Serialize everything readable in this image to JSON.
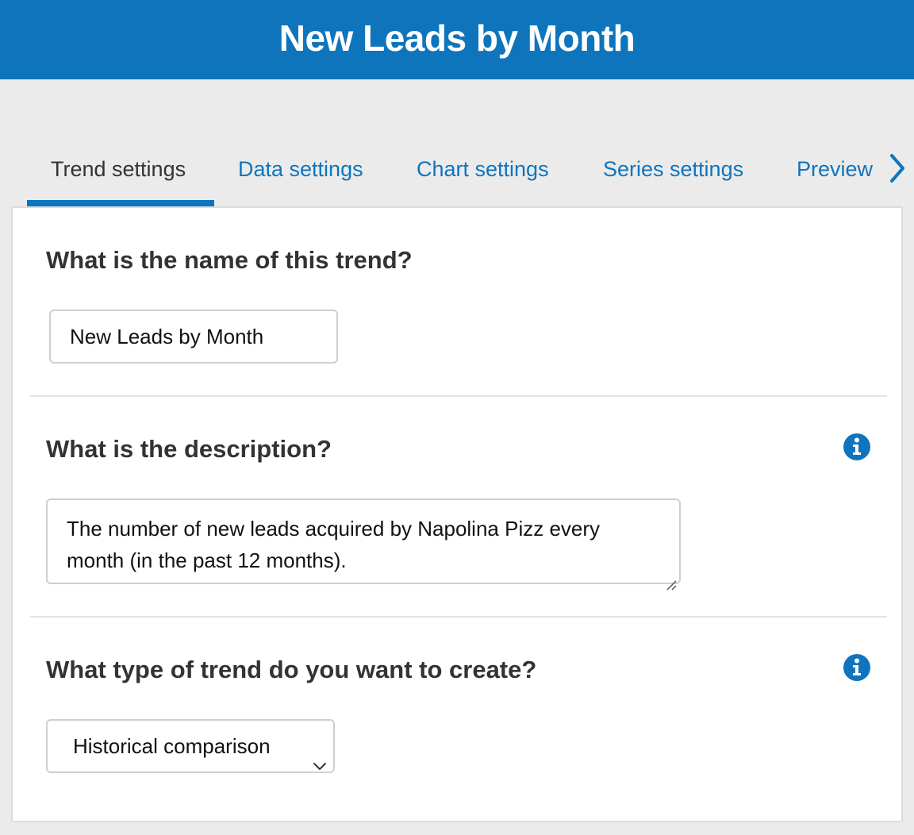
{
  "header": {
    "title": "New Leads by Month"
  },
  "tabs": [
    {
      "label": "Trend settings",
      "active": true
    },
    {
      "label": "Data settings",
      "active": false
    },
    {
      "label": "Chart settings",
      "active": false
    },
    {
      "label": "Series settings",
      "active": false
    },
    {
      "label": "Preview",
      "active": false
    }
  ],
  "tab_next_icon": "chevron-right-icon",
  "sections": {
    "name": {
      "heading": "What is the name of this trend?",
      "value": "New Leads by Month"
    },
    "description": {
      "heading": "What is the description?",
      "value": "The number of new leads acquired by Napolina Pizz every month (in the past 12 months).",
      "info_icon": "info-icon"
    },
    "type": {
      "heading": "What type of trend do you want to create?",
      "selected": "Historical comparison",
      "info_icon": "info-icon"
    }
  },
  "colors": {
    "accent": "#0e75bd",
    "background": "#ebebeb",
    "panel": "#ffffff",
    "text": "#333333"
  }
}
